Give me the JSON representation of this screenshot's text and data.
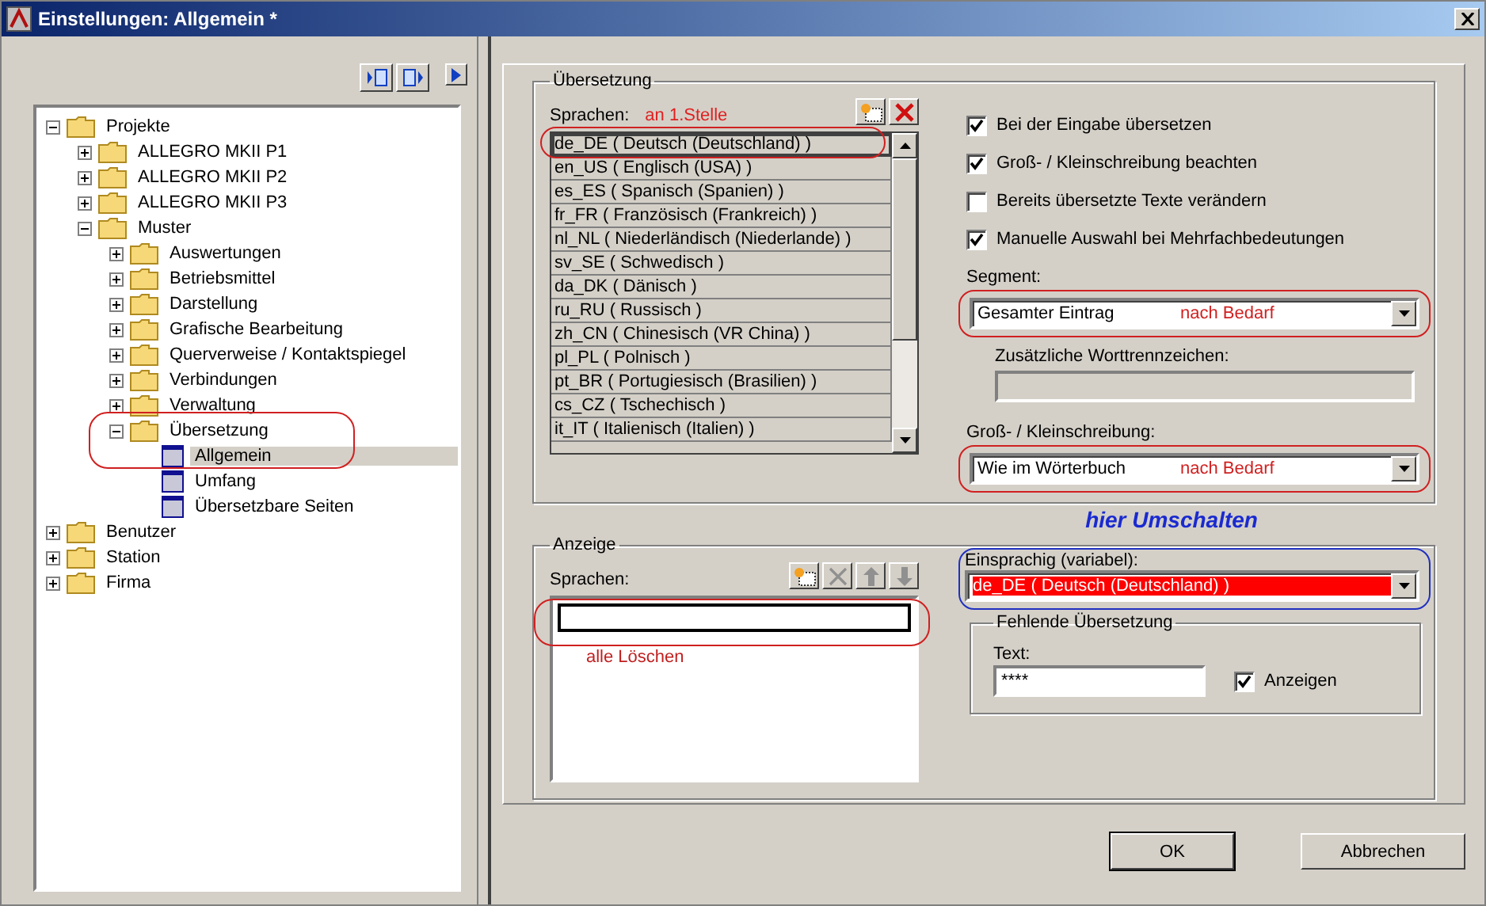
{
  "window": {
    "title": "Einstellungen: Allgemein *"
  },
  "tree": [
    {
      "label": "Projekte",
      "kind": "folder",
      "expanded": true,
      "selected": false,
      "children": [
        {
          "label": "ALLEGRO MKII P1",
          "kind": "folder",
          "expanded": false,
          "selected": false
        },
        {
          "label": "ALLEGRO MKII P2",
          "kind": "folder",
          "expanded": false,
          "selected": false
        },
        {
          "label": "ALLEGRO MKII P3",
          "kind": "folder",
          "expanded": false,
          "selected": false
        },
        {
          "label": "Muster",
          "kind": "folder",
          "expanded": true,
          "selected": false,
          "children": [
            {
              "label": "Auswertungen",
              "kind": "folder",
              "expanded": false,
              "selected": false
            },
            {
              "label": "Betriebsmittel",
              "kind": "folder",
              "expanded": false,
              "selected": false
            },
            {
              "label": "Darstellung",
              "kind": "folder",
              "expanded": false,
              "selected": false
            },
            {
              "label": "Grafische Bearbeitung",
              "kind": "folder",
              "expanded": false,
              "selected": false
            },
            {
              "label": "Querverweise / Kontaktspiegel",
              "kind": "folder",
              "expanded": false,
              "selected": false
            },
            {
              "label": "Verbindungen",
              "kind": "folder",
              "expanded": false,
              "selected": false
            },
            {
              "label": "Verwaltung",
              "kind": "folder",
              "expanded": false,
              "selected": false
            },
            {
              "label": "Übersetzung",
              "kind": "folder",
              "expanded": true,
              "selected": false,
              "children": [
                {
                  "label": "Allgemein",
                  "kind": "page",
                  "selected": true
                },
                {
                  "label": "Umfang",
                  "kind": "page",
                  "selected": false
                },
                {
                  "label": "Übersetzbare Seiten",
                  "kind": "page",
                  "selected": false
                }
              ]
            }
          ]
        }
      ]
    },
    {
      "label": "Benutzer",
      "kind": "folder",
      "expanded": false,
      "selected": false
    },
    {
      "label": "Station",
      "kind": "folder",
      "expanded": false,
      "selected": false
    },
    {
      "label": "Firma",
      "kind": "folder",
      "expanded": false,
      "selected": false
    }
  ],
  "translation": {
    "legend": "Übersetzung",
    "languages_label": "Sprachen:",
    "languages_note": "an 1.Stelle",
    "languages": [
      {
        "label": "de_DE ( Deutsch (Deutschland) )",
        "selected": true
      },
      {
        "label": "en_US ( Englisch (USA) )",
        "selected": false
      },
      {
        "label": "es_ES ( Spanisch (Spanien) )",
        "selected": false
      },
      {
        "label": "fr_FR ( Französisch (Frankreich) )",
        "selected": false
      },
      {
        "label": "nl_NL ( Niederländisch (Niederlande) )",
        "selected": false
      },
      {
        "label": "sv_SE ( Schwedisch )",
        "selected": false
      },
      {
        "label": "da_DK ( Dänisch )",
        "selected": false
      },
      {
        "label": "ru_RU ( Russisch )",
        "selected": false
      },
      {
        "label": "zh_CN ( Chinesisch (VR China) )",
        "selected": false
      },
      {
        "label": "pl_PL ( Polnisch )",
        "selected": false
      },
      {
        "label": "pt_BR ( Portugiesisch (Brasilien) )",
        "selected": false
      },
      {
        "label": "cs_CZ ( Tschechisch )",
        "selected": false
      },
      {
        "label": "it_IT ( Italienisch (Italien) )",
        "selected": false
      }
    ],
    "options": [
      {
        "label": "Bei der Eingabe übersetzen",
        "checked": true
      },
      {
        "label": "Groß- / Kleinschreibung beachten",
        "checked": true
      },
      {
        "label": "Bereits übersetzte Texte verändern",
        "checked": false
      },
      {
        "label": "Manuelle Auswahl bei Mehrfachbedeutungen",
        "checked": true
      }
    ],
    "segment": {
      "label": "Segment:",
      "value": "Gesamter Eintrag",
      "note": "nach Bedarf"
    },
    "word_separators": {
      "label": "Zusätzliche Worttrennzeichen:",
      "disabled": true
    },
    "case": {
      "label": "Groß- / Kleinschreibung:",
      "value": "Wie im Wörterbuch",
      "note": "nach Bedarf"
    }
  },
  "annotation": "hier Umschalten",
  "display": {
    "legend": "Anzeige",
    "languages_label": "Sprachen:",
    "note": "alle Löschen",
    "monolingual": {
      "label": "Einsprachig (variabel):",
      "value": "de_DE ( Deutsch (Deutschland) )"
    },
    "missing": {
      "legend": "Fehlende Übersetzung",
      "text_label": "Text:",
      "text_value": "****",
      "show": {
        "label": "Anzeigen",
        "checked": true
      }
    }
  },
  "buttons": [
    {
      "label": "OK",
      "default": true
    },
    {
      "label": "Abbrechen",
      "default": false
    }
  ]
}
